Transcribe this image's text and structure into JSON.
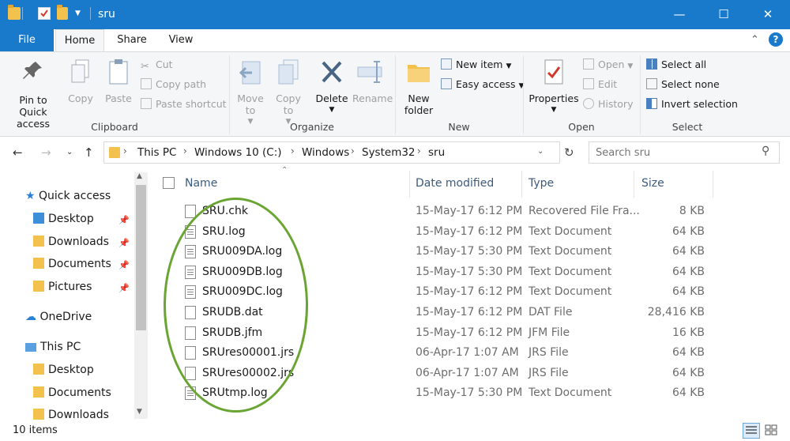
{
  "window": {
    "title": "sru",
    "minimize": "—",
    "maximize": "☐",
    "close": "✕"
  },
  "tabs": [
    {
      "label": "File"
    },
    {
      "label": "Home"
    },
    {
      "label": "Share"
    },
    {
      "label": "View"
    }
  ],
  "ribbon": {
    "clipboard": {
      "label": "Clipboard",
      "pin": "Pin to Quick access",
      "copy": "Copy",
      "paste": "Paste",
      "cut": "Cut",
      "copy_path": "Copy path",
      "paste_shortcut": "Paste shortcut"
    },
    "organize": {
      "label": "Organize",
      "move_to": "Move to",
      "copy_to": "Copy to",
      "delete": "Delete",
      "rename": "Rename"
    },
    "new": {
      "label": "New",
      "new_folder": "New folder",
      "new_item": "New item",
      "easy_access": "Easy access"
    },
    "open": {
      "label": "Open",
      "properties": "Properties",
      "open": "Open",
      "edit": "Edit",
      "history": "History"
    },
    "select": {
      "label": "Select",
      "select_all": "Select all",
      "select_none": "Select none",
      "invert": "Invert selection"
    }
  },
  "breadcrumb": [
    "This PC",
    "Windows 10 (C:)",
    "Windows",
    "System32",
    "sru"
  ],
  "search": {
    "placeholder": "Search sru"
  },
  "nav": [
    {
      "label": "Quick access"
    },
    {
      "label": "Desktop"
    },
    {
      "label": "Downloads"
    },
    {
      "label": "Documents"
    },
    {
      "label": "Pictures"
    },
    {
      "label": "OneDrive"
    },
    {
      "label": "This PC"
    },
    {
      "label": "Desktop"
    },
    {
      "label": "Documents"
    },
    {
      "label": "Downloads"
    }
  ],
  "columns": {
    "name": "Name",
    "date": "Date modified",
    "type": "Type",
    "size": "Size"
  },
  "files": [
    {
      "name": "SRU.chk",
      "date": "15-May-17 6:12 PM",
      "type": "Recovered File Fra...",
      "size": "8 KB"
    },
    {
      "name": "SRU.log",
      "date": "15-May-17 6:12 PM",
      "type": "Text Document",
      "size": "64 KB"
    },
    {
      "name": "SRU009DA.log",
      "date": "15-May-17 5:30 PM",
      "type": "Text Document",
      "size": "64 KB"
    },
    {
      "name": "SRU009DB.log",
      "date": "15-May-17 5:30 PM",
      "type": "Text Document",
      "size": "64 KB"
    },
    {
      "name": "SRU009DC.log",
      "date": "15-May-17 6:12 PM",
      "type": "Text Document",
      "size": "64 KB"
    },
    {
      "name": "SRUDB.dat",
      "date": "15-May-17 6:12 PM",
      "type": "DAT File",
      "size": "28,416 KB"
    },
    {
      "name": "SRUDB.jfm",
      "date": "15-May-17 6:12 PM",
      "type": "JFM File",
      "size": "16 KB"
    },
    {
      "name": "SRUres00001.jrs",
      "date": "06-Apr-17 1:07 AM",
      "type": "JRS File",
      "size": "64 KB"
    },
    {
      "name": "SRUres00002.jrs",
      "date": "06-Apr-17 1:07 AM",
      "type": "JRS File",
      "size": "64 KB"
    },
    {
      "name": "SRUtmp.log",
      "date": "15-May-17 5:30 PM",
      "type": "Text Document",
      "size": "64 KB"
    }
  ],
  "status": {
    "count": "10 items"
  },
  "colors": {
    "titlebar": "#1979ca",
    "highlight": "#6aa533",
    "accent": "#1979ca"
  }
}
